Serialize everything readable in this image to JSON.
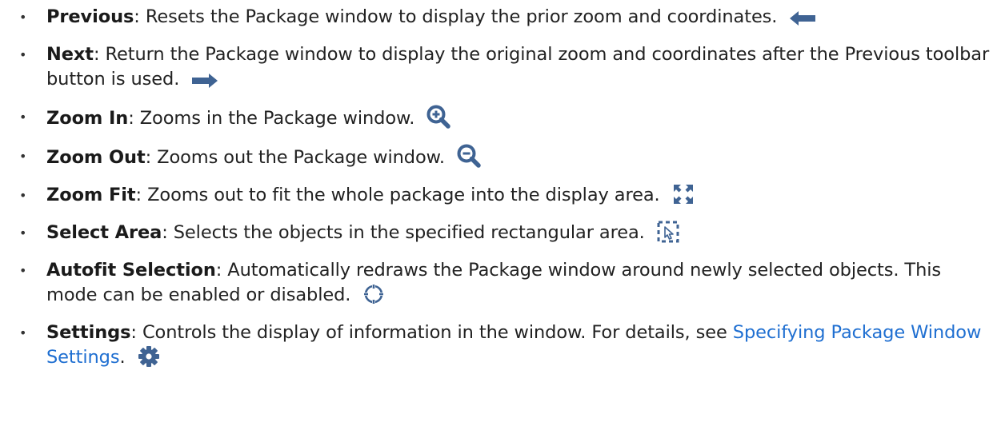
{
  "bullet_glyph": "•",
  "icon_color": "#3f6393",
  "link_color": "#1f6fd1",
  "items": [
    {
      "term": "Previous",
      "separator": ":",
      "description": " Resets the Package window to display the prior zoom and coordinates.",
      "icon": "arrow-left-icon"
    },
    {
      "term": "Next",
      "separator": ":",
      "description": " Return the Package window to display the original zoom and coordinates after the Previous toolbar button is used.",
      "icon": "arrow-right-icon"
    },
    {
      "term": "Zoom In",
      "separator": ":",
      "description": " Zooms in the Package window.",
      "icon": "zoom-in-icon"
    },
    {
      "term": "Zoom Out",
      "separator": ":",
      "description": " Zooms out the Package window.",
      "icon": "zoom-out-icon"
    },
    {
      "term": "Zoom Fit",
      "separator": ":",
      "description": " Zooms out to fit the whole package into the display area.",
      "icon": "zoom-fit-icon"
    },
    {
      "term": "Select Area",
      "separator": ":",
      "description": " Selects the objects in the specified rectangular area.",
      "icon": "select-area-icon"
    },
    {
      "term": "Autofit Selection",
      "separator": ":",
      "description": " Automatically redraws the Package window around newly selected objects. This mode can be enabled or disabled.",
      "icon": "autofit-selection-icon"
    },
    {
      "term": "Settings",
      "separator": ":",
      "description": " Controls the display of information in the window. For details, see ",
      "link": "Specifying Package Window Settings",
      "after_link": ".",
      "icon": "gear-icon"
    }
  ]
}
